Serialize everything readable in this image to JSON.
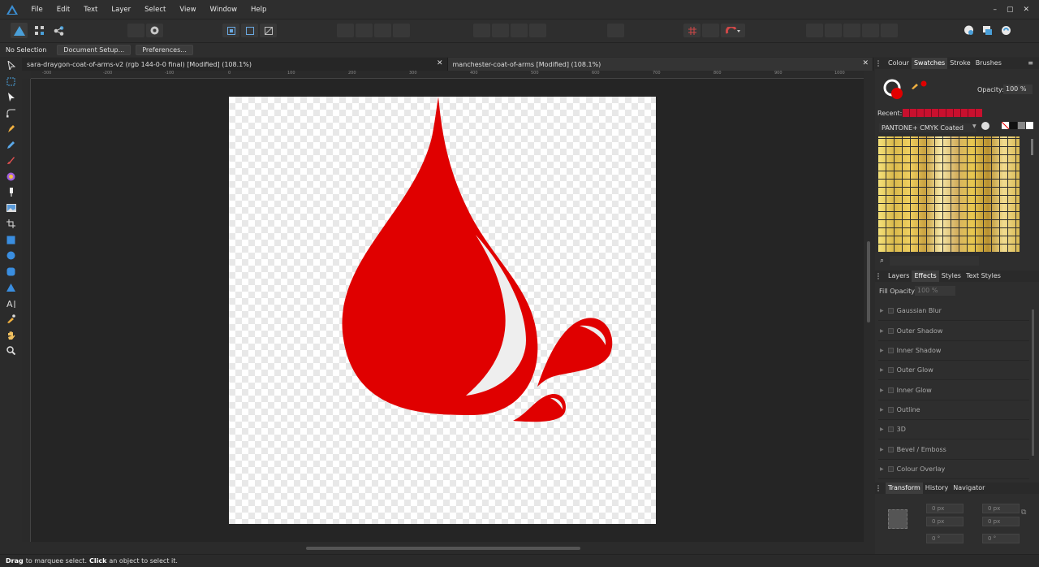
{
  "menu": {
    "items": [
      "File",
      "Edit",
      "Text",
      "Layer",
      "Select",
      "View",
      "Window",
      "Help"
    ]
  },
  "window": {
    "minimize": "–",
    "restore": "▢",
    "close": "✕"
  },
  "context": {
    "selection": "No Selection",
    "document_setup": "Document Setup...",
    "preferences": "Preferences..."
  },
  "tabs": [
    {
      "title": "sara-draygon-coat-of-arms-v2 (rgb 144-0-0 final) [Modified] (108.1%)",
      "close": "✕"
    },
    {
      "title": "manchester-coat-of-arms [Modified] (108.1%)",
      "close": "✕"
    }
  ],
  "ruler": {
    "h_labels": [
      "-300",
      "-200",
      "-100",
      "0",
      "100",
      "200",
      "300",
      "400",
      "500",
      "600",
      "700",
      "800",
      "900",
      "1000"
    ]
  },
  "top_panel": {
    "tabs": [
      "Colour",
      "Swatches",
      "Stroke",
      "Brushes"
    ],
    "active": "Swatches",
    "opacity_label": "Opacity:",
    "opacity_value": "100 %",
    "recent_label": "Recent:",
    "palette": "PANTONE+ CMYK Coated",
    "fill_color": "#e00000"
  },
  "effects_panel": {
    "tabs": [
      "Layers",
      "Effects",
      "Styles",
      "Text Styles"
    ],
    "active": "Effects",
    "fill_opacity_label": "Fill Opacity:",
    "fill_opacity_value": "100 %",
    "effects": [
      "Gaussian Blur",
      "Outer Shadow",
      "Inner Shadow",
      "Outer Glow",
      "Inner Glow",
      "Outline",
      "3D",
      "Bevel / Emboss",
      "Colour Overlay"
    ]
  },
  "transform_panel": {
    "tabs": [
      "Transform",
      "History",
      "Navigator"
    ],
    "active": "Transform",
    "x": "0 px",
    "y": "0 px",
    "w": "0 px",
    "h": "0 px",
    "r": "0 °",
    "s": "0 °"
  },
  "status": {
    "drag": "Drag",
    "drag_text": "to marquee select.",
    "click": "Click",
    "click_text": "an object to select it."
  },
  "colors": {
    "drop_red": "#e00000",
    "accent": "#4a9fd8"
  }
}
